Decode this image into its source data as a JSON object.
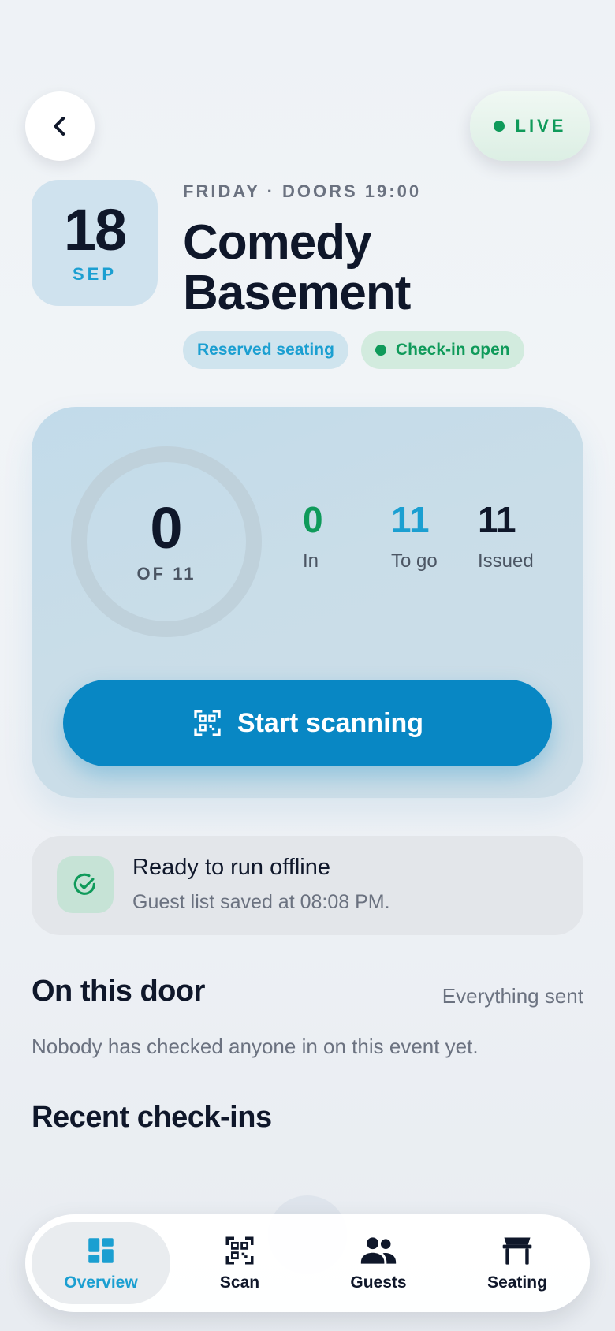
{
  "header": {
    "live_label": "LIVE"
  },
  "event": {
    "date_day": "18",
    "date_month": "SEP",
    "meta": "FRIDAY · DOORS 19:00",
    "title": "Comedy Basement",
    "tags": [
      "Reserved seating",
      "Check-in open"
    ]
  },
  "stats": {
    "checked_in": "0",
    "of_total": "OF 11",
    "in_value": "0",
    "in_label": "In",
    "togo_value": "11",
    "togo_label": "To go",
    "issued_value": "11",
    "issued_label": "Issued",
    "progress_fraction": 0
  },
  "scan_button": {
    "label": "Start scanning"
  },
  "offline": {
    "title": "Ready to run offline",
    "subtitle": "Guest list saved at 08:08 PM."
  },
  "door": {
    "title": "On this door",
    "status": "Everything sent",
    "empty_message": "Nobody has checked anyone in on this event yet."
  },
  "recent": {
    "title": "Recent check-ins"
  },
  "tabbar": {
    "items": [
      {
        "label": "Overview",
        "icon": "dashboard-icon",
        "active": true
      },
      {
        "label": "Scan",
        "icon": "qr-code-icon",
        "active": false
      },
      {
        "label": "Guests",
        "icon": "group-icon",
        "active": false
      },
      {
        "label": "Seating",
        "icon": "table-icon",
        "active": false
      }
    ]
  },
  "colors": {
    "accent": "#1b9fd1",
    "primary_button": "#0887c4",
    "success": "#0f9a5a",
    "text": "#0f172a",
    "muted": "#6b7280"
  }
}
